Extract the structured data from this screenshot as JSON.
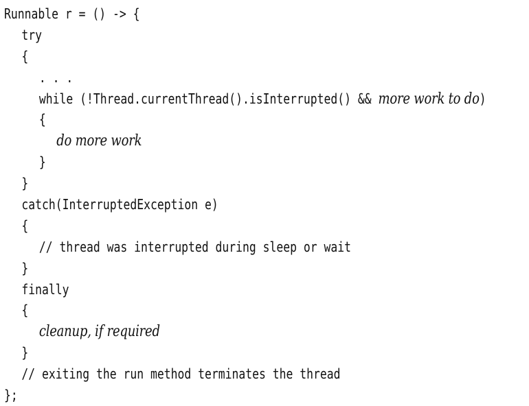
{
  "code": {
    "l01": "Runnable r = () -> {",
    "l02": "try",
    "l03": "{",
    "l04": ". . .",
    "l05_code": "while (!Thread.currentThread().isInterrupted() && ",
    "l05_italic": "more work to do",
    "l05_end": ")",
    "l06": "{",
    "l07_italic": "do more work",
    "l08": "}",
    "l09": "}",
    "l10": "catch(InterruptedException e)",
    "l11": "{",
    "l12": "// thread was interrupted during sleep or wait",
    "l13": "}",
    "l14": "finally",
    "l15": "{",
    "l16_italic": "cleanup, if required",
    "l17": "}",
    "l18": "// exiting the run method terminates the thread",
    "l19": "};"
  }
}
